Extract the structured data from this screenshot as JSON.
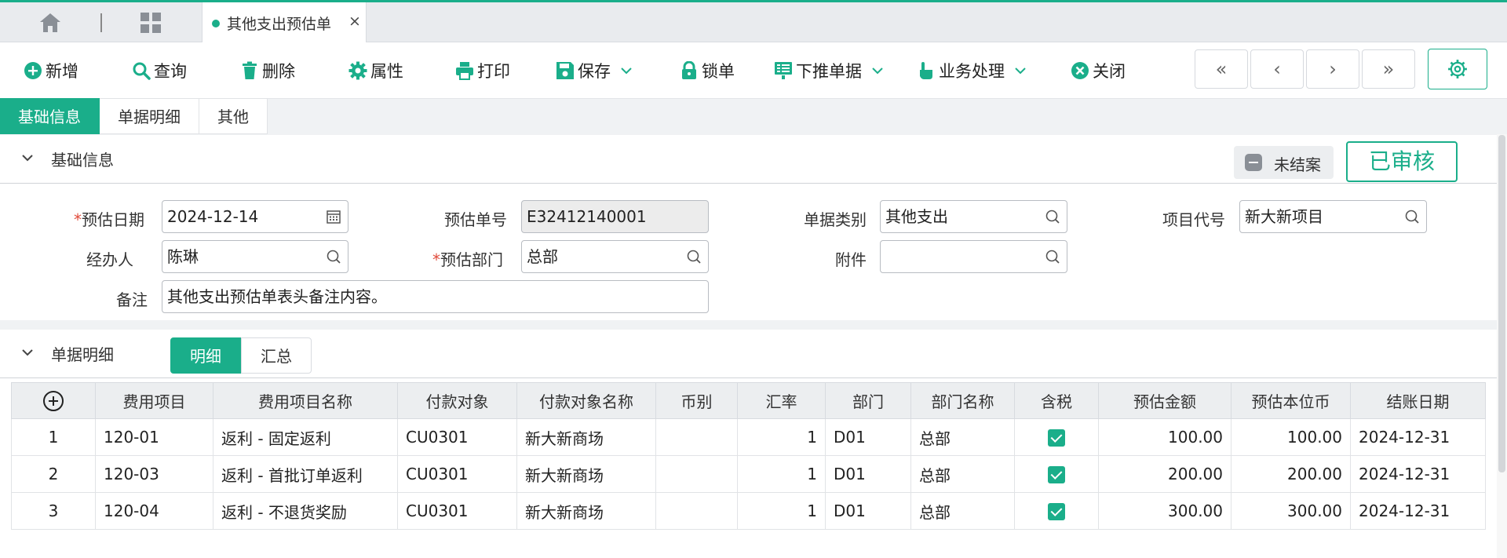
{
  "tabs": {
    "doc_tab_title": "其他支出预估单",
    "doc_tab_close": "×",
    "separator": "|"
  },
  "toolbar": {
    "add": "新增",
    "query": "查询",
    "delete": "删除",
    "properties": "属性",
    "print": "打印",
    "save": "保存",
    "lock": "锁单",
    "push_down": "下推单据",
    "business": "业务处理",
    "close": "关闭",
    "nav_first": "«",
    "nav_prev": "‹",
    "nav_next": "›",
    "nav_last": "»"
  },
  "subtabs": [
    "基础信息",
    "单据明细",
    "其他"
  ],
  "basic": {
    "section_title": "基础信息",
    "status_open": "未结案",
    "status_approved": "已审核",
    "date_label": "预估日期",
    "date_value": "2024-12-14",
    "doc_no_label": "预估单号",
    "doc_no_value": "E32412140001",
    "doc_type_label": "单据类别",
    "doc_type_value": "其他支出",
    "project_label": "项目代号",
    "project_value": "新大新项目",
    "handler_label": "经办人",
    "handler_value": "陈琳",
    "dept_label": "预估部门",
    "dept_value": "总部",
    "attach_label": "附件",
    "attach_value": "",
    "remark_label": "备注",
    "remark_value": "其他支出预估单表头备注内容。",
    "required_mark": "*"
  },
  "detail": {
    "section_title": "单据明细",
    "view_detail": "明细",
    "view_summary": "汇总",
    "columns": [
      "费用项目",
      "费用项目名称",
      "付款对象",
      "付款对象名称",
      "币别",
      "汇率",
      "部门",
      "部门名称",
      "含税",
      "预估金额",
      "预估本位币",
      "结账日期"
    ],
    "rows": [
      {
        "no": "1",
        "item": "120-01",
        "item_name": "返利 - 固定返利",
        "payee": "CU0301",
        "payee_name": "新大新商场",
        "currency": "",
        "rate": "1",
        "dept": "D01",
        "dept_name": "总部",
        "tax": true,
        "amount": "100.00",
        "base_amount": "100.00",
        "close_date": "2024-12-31"
      },
      {
        "no": "2",
        "item": "120-03",
        "item_name": "返利 - 首批订单返利",
        "payee": "CU0301",
        "payee_name": "新大新商场",
        "currency": "",
        "rate": "1",
        "dept": "D01",
        "dept_name": "总部",
        "tax": true,
        "amount": "200.00",
        "base_amount": "200.00",
        "close_date": "2024-12-31"
      },
      {
        "no": "3",
        "item": "120-04",
        "item_name": "返利 - 不退货奖励",
        "payee": "CU0301",
        "payee_name": "新大新商场",
        "currency": "",
        "rate": "1",
        "dept": "D01",
        "dept_name": "总部",
        "tax": true,
        "amount": "300.00",
        "base_amount": "300.00",
        "close_date": "2024-12-31"
      }
    ]
  },
  "colors": {
    "accent": "#1aae8a",
    "required": "#e04a3a"
  }
}
